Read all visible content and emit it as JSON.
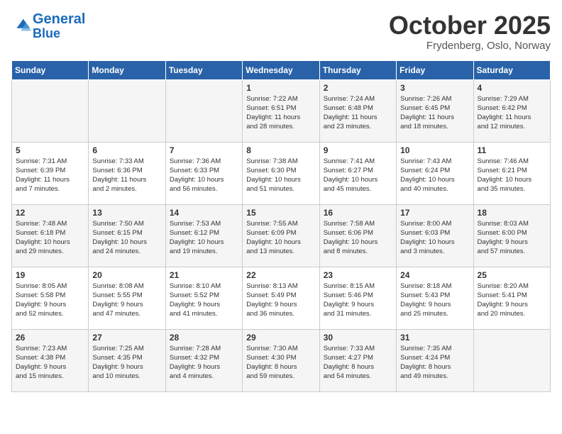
{
  "header": {
    "logo_line1": "General",
    "logo_line2": "Blue",
    "month": "October 2025",
    "location": "Frydenberg, Oslo, Norway"
  },
  "weekdays": [
    "Sunday",
    "Monday",
    "Tuesday",
    "Wednesday",
    "Thursday",
    "Friday",
    "Saturday"
  ],
  "weeks": [
    [
      {
        "day": "",
        "info": ""
      },
      {
        "day": "",
        "info": ""
      },
      {
        "day": "",
        "info": ""
      },
      {
        "day": "1",
        "info": "Sunrise: 7:22 AM\nSunset: 6:51 PM\nDaylight: 11 hours\nand 28 minutes."
      },
      {
        "day": "2",
        "info": "Sunrise: 7:24 AM\nSunset: 6:48 PM\nDaylight: 11 hours\nand 23 minutes."
      },
      {
        "day": "3",
        "info": "Sunrise: 7:26 AM\nSunset: 6:45 PM\nDaylight: 11 hours\nand 18 minutes."
      },
      {
        "day": "4",
        "info": "Sunrise: 7:29 AM\nSunset: 6:42 PM\nDaylight: 11 hours\nand 12 minutes."
      }
    ],
    [
      {
        "day": "5",
        "info": "Sunrise: 7:31 AM\nSunset: 6:39 PM\nDaylight: 11 hours\nand 7 minutes."
      },
      {
        "day": "6",
        "info": "Sunrise: 7:33 AM\nSunset: 6:36 PM\nDaylight: 11 hours\nand 2 minutes."
      },
      {
        "day": "7",
        "info": "Sunrise: 7:36 AM\nSunset: 6:33 PM\nDaylight: 10 hours\nand 56 minutes."
      },
      {
        "day": "8",
        "info": "Sunrise: 7:38 AM\nSunset: 6:30 PM\nDaylight: 10 hours\nand 51 minutes."
      },
      {
        "day": "9",
        "info": "Sunrise: 7:41 AM\nSunset: 6:27 PM\nDaylight: 10 hours\nand 45 minutes."
      },
      {
        "day": "10",
        "info": "Sunrise: 7:43 AM\nSunset: 6:24 PM\nDaylight: 10 hours\nand 40 minutes."
      },
      {
        "day": "11",
        "info": "Sunrise: 7:46 AM\nSunset: 6:21 PM\nDaylight: 10 hours\nand 35 minutes."
      }
    ],
    [
      {
        "day": "12",
        "info": "Sunrise: 7:48 AM\nSunset: 6:18 PM\nDaylight: 10 hours\nand 29 minutes."
      },
      {
        "day": "13",
        "info": "Sunrise: 7:50 AM\nSunset: 6:15 PM\nDaylight: 10 hours\nand 24 minutes."
      },
      {
        "day": "14",
        "info": "Sunrise: 7:53 AM\nSunset: 6:12 PM\nDaylight: 10 hours\nand 19 minutes."
      },
      {
        "day": "15",
        "info": "Sunrise: 7:55 AM\nSunset: 6:09 PM\nDaylight: 10 hours\nand 13 minutes."
      },
      {
        "day": "16",
        "info": "Sunrise: 7:58 AM\nSunset: 6:06 PM\nDaylight: 10 hours\nand 8 minutes."
      },
      {
        "day": "17",
        "info": "Sunrise: 8:00 AM\nSunset: 6:03 PM\nDaylight: 10 hours\nand 3 minutes."
      },
      {
        "day": "18",
        "info": "Sunrise: 8:03 AM\nSunset: 6:00 PM\nDaylight: 9 hours\nand 57 minutes."
      }
    ],
    [
      {
        "day": "19",
        "info": "Sunrise: 8:05 AM\nSunset: 5:58 PM\nDaylight: 9 hours\nand 52 minutes."
      },
      {
        "day": "20",
        "info": "Sunrise: 8:08 AM\nSunset: 5:55 PM\nDaylight: 9 hours\nand 47 minutes."
      },
      {
        "day": "21",
        "info": "Sunrise: 8:10 AM\nSunset: 5:52 PM\nDaylight: 9 hours\nand 41 minutes."
      },
      {
        "day": "22",
        "info": "Sunrise: 8:13 AM\nSunset: 5:49 PM\nDaylight: 9 hours\nand 36 minutes."
      },
      {
        "day": "23",
        "info": "Sunrise: 8:15 AM\nSunset: 5:46 PM\nDaylight: 9 hours\nand 31 minutes."
      },
      {
        "day": "24",
        "info": "Sunrise: 8:18 AM\nSunset: 5:43 PM\nDaylight: 9 hours\nand 25 minutes."
      },
      {
        "day": "25",
        "info": "Sunrise: 8:20 AM\nSunset: 5:41 PM\nDaylight: 9 hours\nand 20 minutes."
      }
    ],
    [
      {
        "day": "26",
        "info": "Sunrise: 7:23 AM\nSunset: 4:38 PM\nDaylight: 9 hours\nand 15 minutes."
      },
      {
        "day": "27",
        "info": "Sunrise: 7:25 AM\nSunset: 4:35 PM\nDaylight: 9 hours\nand 10 minutes."
      },
      {
        "day": "28",
        "info": "Sunrise: 7:28 AM\nSunset: 4:32 PM\nDaylight: 9 hours\nand 4 minutes."
      },
      {
        "day": "29",
        "info": "Sunrise: 7:30 AM\nSunset: 4:30 PM\nDaylight: 8 hours\nand 59 minutes."
      },
      {
        "day": "30",
        "info": "Sunrise: 7:33 AM\nSunset: 4:27 PM\nDaylight: 8 hours\nand 54 minutes."
      },
      {
        "day": "31",
        "info": "Sunrise: 7:35 AM\nSunset: 4:24 PM\nDaylight: 8 hours\nand 49 minutes."
      },
      {
        "day": "",
        "info": ""
      }
    ]
  ]
}
